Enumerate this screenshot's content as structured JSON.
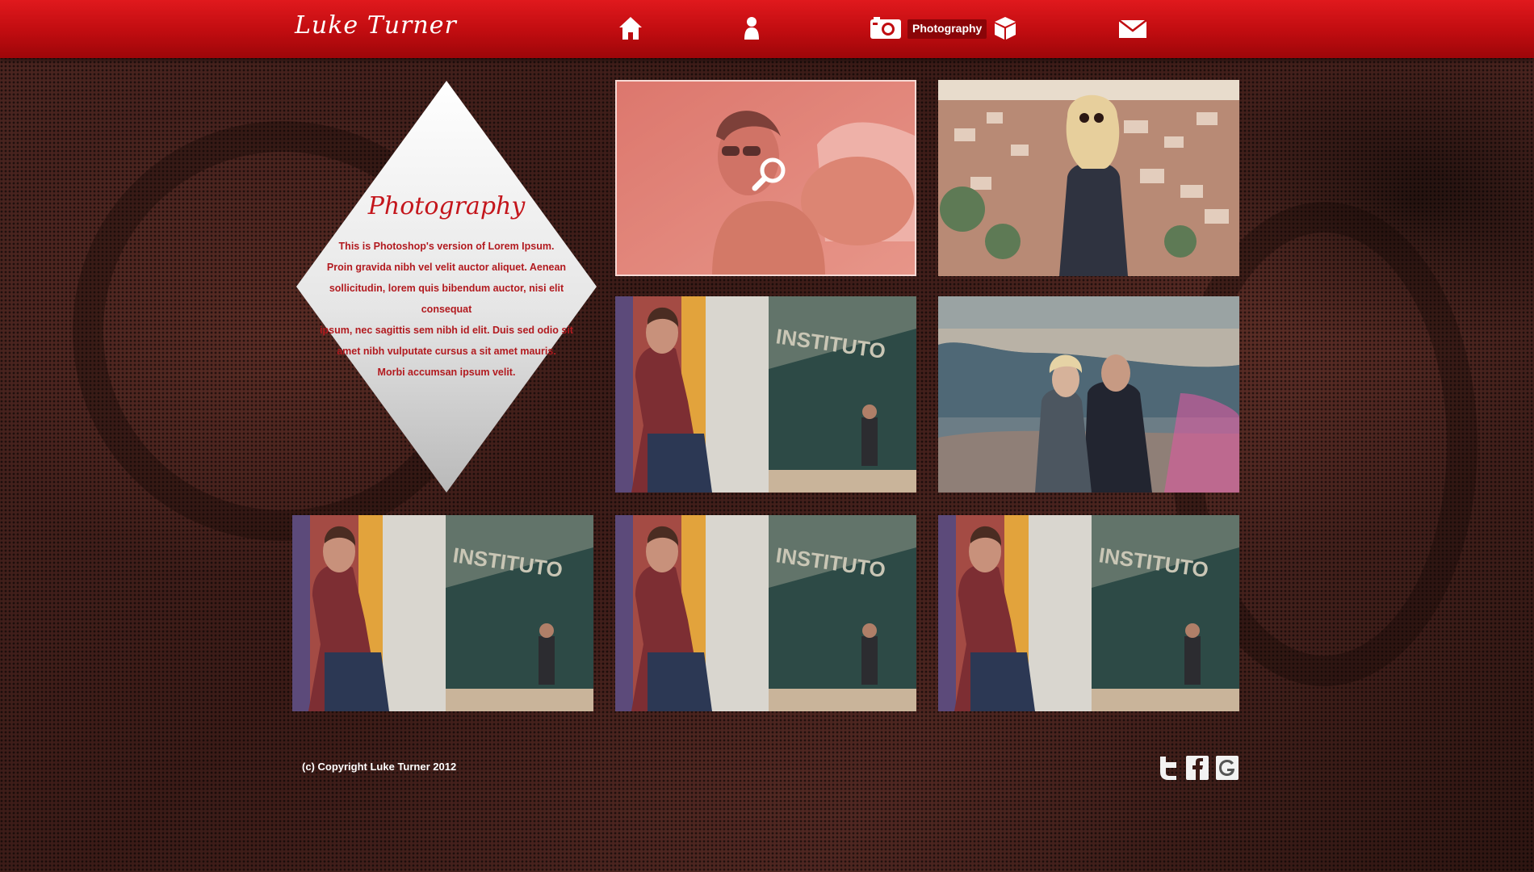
{
  "header": {
    "logo": "Luke Turner",
    "nav": {
      "home_icon": "home-icon",
      "about_icon": "person-icon",
      "photography_icon": "camera-icon",
      "photography_label": "Photography",
      "portfolio_icon": "box-icon",
      "contact_icon": "mail-icon"
    }
  },
  "intro": {
    "title": "Photography",
    "lines": [
      "This is Photoshop's version  of Lorem Ipsum.",
      "Proin gravida nibh vel velit auctor aliquet. Aenean",
      "sollicitudin, lorem quis bibendum auctor, nisi elit consequat",
      "ipsum, nec sagittis sem nibh id elit. Duis sed odio sit",
      "amet nibh vulputate cursus a sit amet mauris.",
      "Morbi accumsan ipsum velit."
    ]
  },
  "gallery": {
    "photos": [
      {
        "id": "photo-1",
        "subject": "man-in-sunglasses",
        "hover_icon": "magnifier-icon"
      },
      {
        "id": "photo-2",
        "subject": "woman-on-hillside"
      },
      {
        "id": "photo-3",
        "subject": "instituto-wall"
      },
      {
        "id": "photo-4",
        "subject": "couple-by-bay"
      },
      {
        "id": "photo-5",
        "subject": "instituto-wall"
      },
      {
        "id": "photo-6",
        "subject": "instituto-wall"
      },
      {
        "id": "photo-7",
        "subject": "instituto-wall"
      }
    ],
    "wall_text": "INSTITUTO"
  },
  "footer": {
    "copyright": "(c) Copyright Luke Turner 2012",
    "social": [
      "twitter-icon",
      "facebook-icon",
      "google-icon"
    ]
  },
  "colors": {
    "header_red": "#c00c10",
    "title_red": "#c4161c",
    "text_red": "#b21a1f",
    "background": "#3a1a16"
  }
}
